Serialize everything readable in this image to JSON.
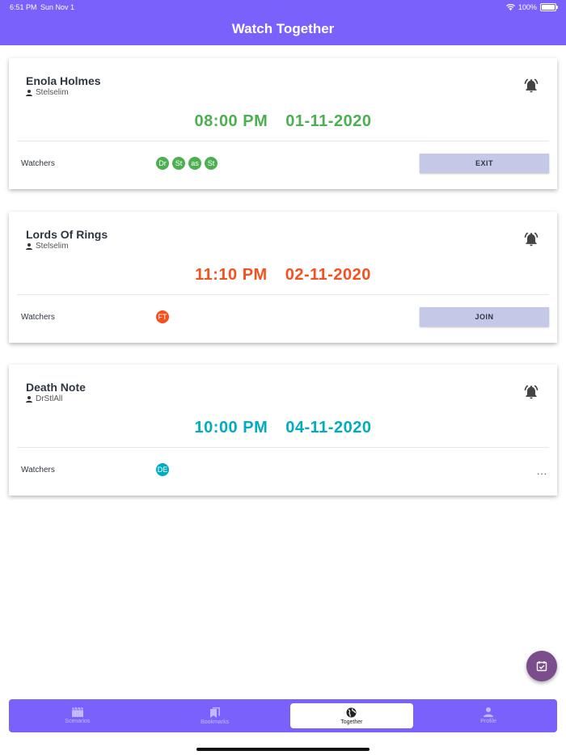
{
  "status_bar": {
    "time": "6:51 PM",
    "date": "Sun Nov 1",
    "battery": "100%"
  },
  "header": {
    "title": "Watch Together"
  },
  "events": [
    {
      "title": "Enola Holmes",
      "owner": "Stelselim",
      "time": "08:00 PM",
      "date": "01-11-2020",
      "color": "#4caf50",
      "watchers_label": "Watchers",
      "watchers": [
        "Dr",
        "St",
        "as",
        "St"
      ],
      "action": "EXIT"
    },
    {
      "title": "Lords Of Rings",
      "owner": "Stelselim",
      "time": "11:10 PM",
      "date": "02-11-2020",
      "color": "#f4511e",
      "watchers_label": "Watchers",
      "watchers": [
        "FT"
      ],
      "action": "JOIN"
    },
    {
      "title": "Death Note",
      "owner": "DrStlAll",
      "time": "10:00 PM",
      "date": "04-11-2020",
      "color": "#00acc1",
      "watchers_label": "Watchers",
      "watchers": [
        "DE"
      ],
      "action": "..."
    }
  ],
  "bottom_nav": {
    "items": [
      {
        "label": "Scenarios",
        "icon": "movie-icon"
      },
      {
        "label": "Bookmarks",
        "icon": "bookmarks-icon"
      },
      {
        "label": "Together",
        "icon": "globe-icon"
      },
      {
        "label": "Profile",
        "icon": "person-icon"
      }
    ]
  },
  "fab_icon": "calendar-check-icon"
}
